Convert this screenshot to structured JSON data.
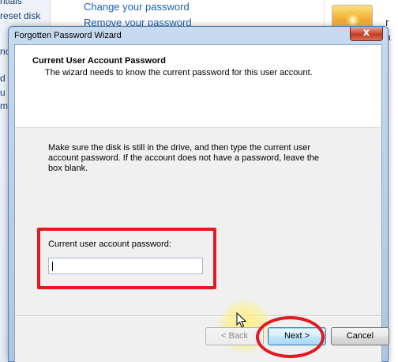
{
  "background": {
    "left_items": [
      "ntials",
      "reset disk",
      "ncr",
      "d u",
      "u",
      "m"
    ],
    "links": [
      "Change your password",
      "Remove your password"
    ],
    "right_texts": [
      "r",
      "a"
    ]
  },
  "dialog": {
    "title": "Forgotten Password Wizard",
    "close_label": "x",
    "header_title": "Current User Account Password",
    "header_subtitle": "The wizard needs to know the current password for this user account.",
    "instructions": "Make sure the disk is still in the drive, and then type the current user account password. If the account does not have a password, leave the box blank.",
    "password_label": "Current user account password:",
    "password_value": "",
    "buttons": {
      "back": "< Back",
      "next": "Next >",
      "cancel": "Cancel"
    }
  },
  "colors": {
    "annotation": "#e01923",
    "link": "#1a5fb4",
    "dialog_frame": "#b7cee8"
  },
  "icons": [
    "close-icon",
    "mouse-cursor-icon",
    "user-picture-icon"
  ]
}
